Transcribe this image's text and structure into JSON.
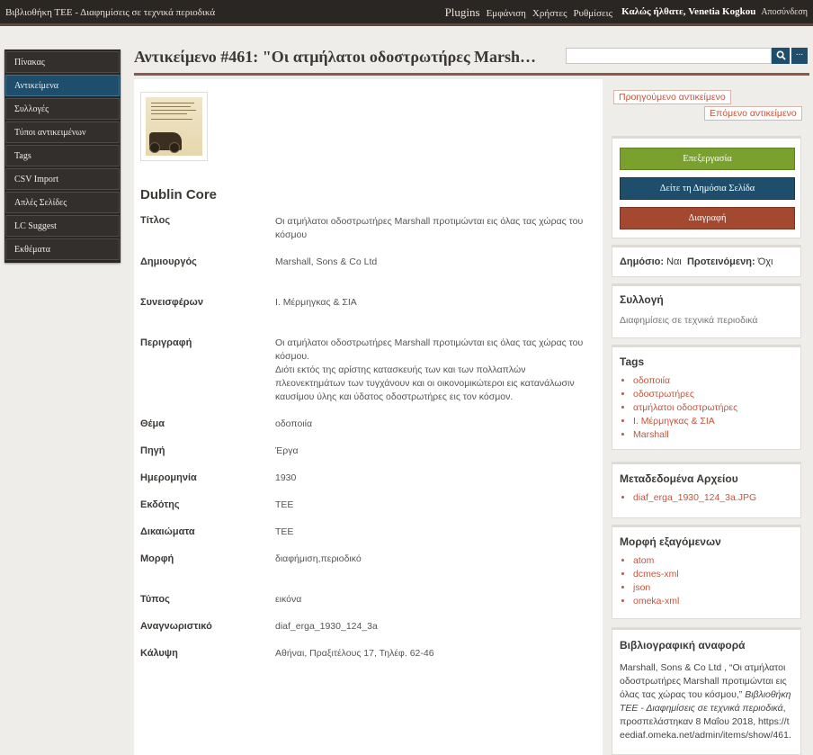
{
  "topbar": {
    "site_title": "Βιβλιοθήκη ΤΕΕ - Διαφημίσεις σε τεχνικά περιοδικά",
    "nav": [
      "Plugins",
      "Εμφάνιση",
      "Χρήστες",
      "Ρυθμίσεις"
    ],
    "welcome": "Καλώς ήλθατε, Venetia Kogkou",
    "logout": "Αποσύνδεση"
  },
  "sidebar": {
    "items": [
      {
        "label": "Πίνακας",
        "active": false
      },
      {
        "label": "Αντικείμενα",
        "active": true
      },
      {
        "label": "Συλλογές",
        "active": false
      },
      {
        "label": "Τύποι αντικειμένων",
        "active": false
      },
      {
        "label": "Tags",
        "active": false
      },
      {
        "label": "CSV Import",
        "active": false
      },
      {
        "label": "Απλές Σελίδες",
        "active": false
      },
      {
        "label": "LC Suggest",
        "active": false
      },
      {
        "label": "Εκθέματα",
        "active": false
      }
    ]
  },
  "header": {
    "title_prefix": "Αντικείμενο ",
    "title_number": "#461",
    "title_rest": ": \"Οι ατμήλατοι οδοστρωτήρες Marsh…",
    "search_value": "",
    "search_icon": "search-icon",
    "advanced_label": "..."
  },
  "item": {
    "thumbnail_icon": "item-image",
    "dc_heading": "Dublin Core",
    "fields": [
      {
        "label": "Τίτλος",
        "value": "Οι ατμήλατοι οδοστρωτήρες Marshall προτιμώνται εις όλας τας χώρας του κόσμου"
      },
      {
        "label": "Δημιουργός",
        "value": "Marshall, Sons & Co Ltd"
      },
      {
        "label": "Συνεισφέρων",
        "value": "Ι. Μέρμηγκας & ΣΙΑ"
      },
      {
        "label": "Περιγραφή",
        "value": "Οι ατμήλατοι οδοστρωτήρες Marshall προτιμώνται εις όλας τας χώρας του κόσμου.\nΔιότι εκτός της αρίστης κατασκευής των και των πολλαπλών πλεονεκτημάτων των τυγχάνουν και οι οικονομικώτεροι εις κατανάλωσιν καυσίμου ύλης και ύδατος οδοστρωτήρες εις τον κόσμον."
      },
      {
        "label": "Θέμα",
        "value": "οδοποιία"
      },
      {
        "label": "Πηγή",
        "value": "Έργα"
      },
      {
        "label": "Ημερομηνία",
        "value": "1930"
      },
      {
        "label": "Εκδότης",
        "value": "ΤΕΕ"
      },
      {
        "label": "Δικαιώματα",
        "value": "ΤΕΕ"
      },
      {
        "label": "Μορφή",
        "value": "διαφήμιση,περιοδικό"
      },
      {
        "label": "Τύπος",
        "value": "εικόνα"
      },
      {
        "label": "Αναγνωριστικό",
        "value": "diaf_erga_1930_124_3a"
      },
      {
        "label": "Κάλυψη",
        "value": "Αθήναι, Πραξιτέλους 17, Τηλέφ. 62-46"
      }
    ]
  },
  "right": {
    "prev_label": "Προηγούμενο αντικείμενο",
    "next_label": "Επόμενο αντικείμενο",
    "edit_label": "Επεξεργασία",
    "view_label": "Δείτε τη Δημόσια Σελίδα",
    "delete_label": "Διαγραφή",
    "public_label": "Δημόσιο:",
    "public_value": "Ναι",
    "featured_label": "Προτεινόμενη:",
    "featured_value": "Όχι",
    "collection_heading": "Συλλογή",
    "collection_value": "Διαφημίσεις σε τεχνικά περιοδικά",
    "tags_heading": "Tags",
    "tags": [
      "οδοποιία",
      "οδοστρωτήρες",
      "ατμήλατοι οδοστρωτήρες",
      "Ι. Μέρμηγκας & ΣΙΑ",
      "Marshall"
    ],
    "files_heading": "Μεταδεδομένα Αρχείου",
    "files": [
      "diaf_erga_1930_124_3a.JPG"
    ],
    "output_heading": "Μορφή εξαγόμενων",
    "outputs": [
      "atom",
      "dcmes-xml",
      "json",
      "omeka-xml"
    ],
    "citation_heading": "Βιβλιογραφική αναφορά",
    "citation_pre": "Marshall, Sons & Co Ltd , “Οι ατμήλατοι οδοστρωτήρες Marshall προτιμώνται εις όλας τας χώρας του κόσμου,”",
    "citation_em": "Βιβλιοθήκη ΤΕΕ - Διαφημίσεις σε τεχνικά περιοδικά",
    "citation_post": ", προσπελάστηκαν 8 Μαΐου 2018, https://teediaf.omeka.net/admin/items/show/461."
  },
  "colors": {
    "accent_blue": "#1f4e6c",
    "edit_green": "#7aa02e",
    "delete_red": "#a4492f",
    "link_orange": "#c4553d",
    "title_rule": "#8b5a47"
  }
}
